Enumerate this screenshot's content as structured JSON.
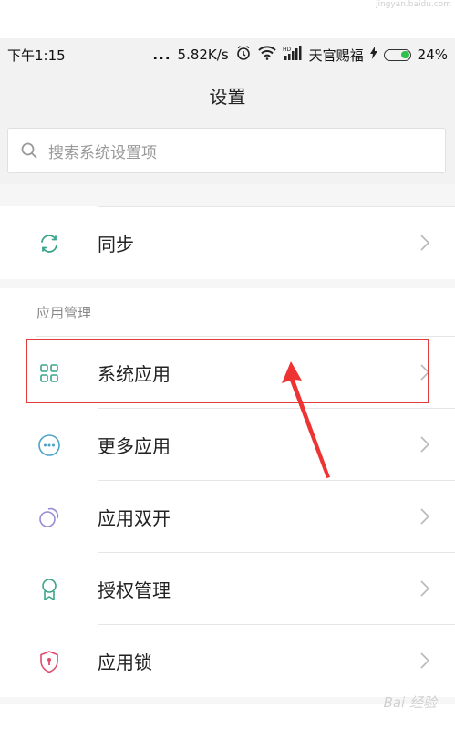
{
  "watermark_top": "jingyan.baidu.com",
  "status_bar": {
    "time": "下午1:15",
    "dots": "...",
    "speed": "5.82K/s",
    "carrier": "天官赐福",
    "battery": "24%",
    "battery_color": "#2ec24a"
  },
  "title": "设置",
  "search": {
    "placeholder": "搜索系统设置项"
  },
  "sync": {
    "label": "同步",
    "icon": "sync-icon"
  },
  "app_management": {
    "section_title": "应用管理",
    "items": [
      {
        "label": "系统应用",
        "icon": "grid-apps-icon",
        "color": "#3aa58a"
      },
      {
        "label": "更多应用",
        "icon": "more-apps-icon",
        "color": "#4aa3c8"
      },
      {
        "label": "应用双开",
        "icon": "dual-apps-icon",
        "color": "#9b8ad6"
      },
      {
        "label": "授权管理",
        "icon": "permission-badge-icon",
        "color": "#3aa58a"
      },
      {
        "label": "应用锁",
        "icon": "app-lock-icon",
        "color": "#e04a6a"
      }
    ]
  },
  "annotation": {
    "highlight_color": "#e23b3b"
  },
  "watermark_br": "Bai 经验"
}
